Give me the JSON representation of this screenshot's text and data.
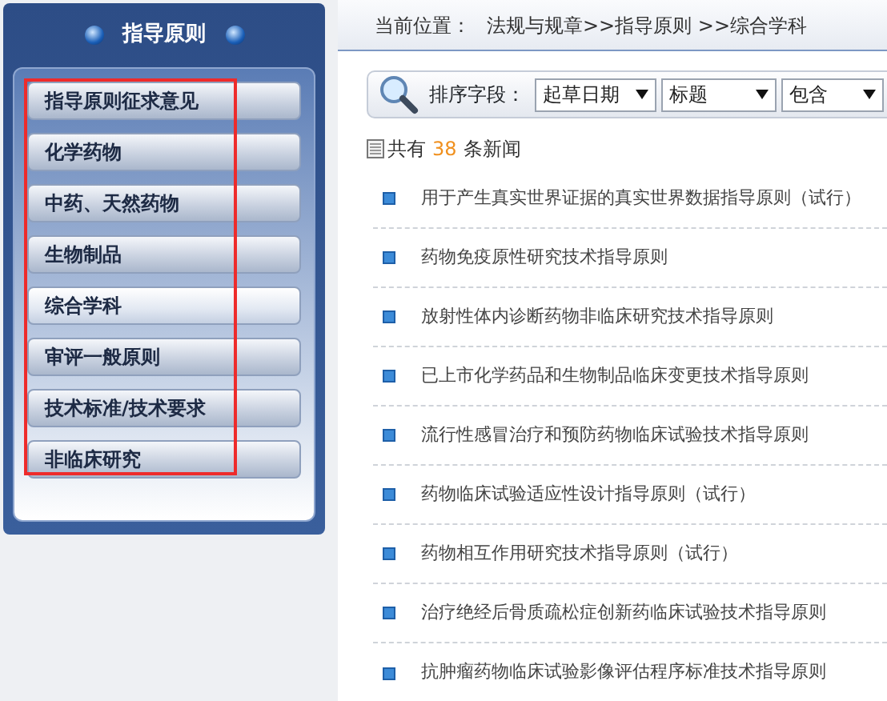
{
  "sidebar": {
    "title": "指导原则",
    "highlight_box": true,
    "items": [
      {
        "label": "指导原则征求意见",
        "selected": false
      },
      {
        "label": "化学药物",
        "selected": false
      },
      {
        "label": "中药、天然药物",
        "selected": false
      },
      {
        "label": "生物制品",
        "selected": false
      },
      {
        "label": "综合学科",
        "selected": true
      },
      {
        "label": "审评一般原则",
        "selected": false
      },
      {
        "label": "技术标准/技术要求",
        "selected": false
      },
      {
        "label": "非临床研究",
        "selected": false
      }
    ]
  },
  "breadcrumb": {
    "label": "当前位置：",
    "path": "法规与规章>>指导原则 >>综合学科"
  },
  "sort_bar": {
    "label": "排序字段：",
    "selects": [
      {
        "value": "起草日期"
      },
      {
        "value": "标题"
      },
      {
        "value": "包含"
      }
    ]
  },
  "count": {
    "prefix": "共有",
    "number": "38",
    "suffix": "条新闻"
  },
  "articles": [
    "用于产生真实世界证据的真实世界数据指导原则（试行）",
    "药物免疫原性研究技术指导原则",
    "放射性体内诊断药物非临床研究技术指导原则",
    "已上市化学药品和生物制品临床变更技术指导原则",
    "流行性感冒治疗和预防药物临床试验技术指导原则",
    "药物临床试验适应性设计指导原则（试行）",
    "药物相互作用研究技术指导原则（试行）",
    "治疗绝经后骨质疏松症创新药临床试验技术指导原则",
    "抗肿瘤药物临床试验影像评估程序标准技术指导原则"
  ]
}
